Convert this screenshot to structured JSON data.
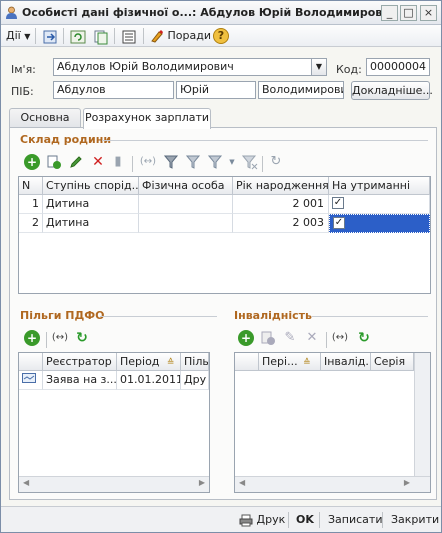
{
  "window": {
    "title": "Особисті дані фізичної о...: Абдулов Юрій Володимирович *",
    "controls": [
      "_",
      "□",
      "×"
    ]
  },
  "toolbar": {
    "actions_label": "Дії",
    "tips_label": "Поради",
    "help_label": "?"
  },
  "form": {
    "name_label": "Ім'я:",
    "name_value": "Абдулов Юрій Володимирович",
    "code_label": "Код:",
    "code_value": "00000004",
    "pib_label": "ПІБ:",
    "surname": "Абдулов",
    "firstname": "Юрій",
    "patronymic": "Володимирович",
    "details_button": "Докладніше..."
  },
  "tabs": [
    {
      "label": "Основна",
      "active": false
    },
    {
      "label": "Розрахунок зарплати",
      "active": true
    }
  ],
  "family": {
    "section_title": "Склад родини",
    "columns": [
      "N",
      "Ступінь спорід...",
      "Фізична особа",
      "Рік народження",
      "На утриманні"
    ],
    "rows": [
      {
        "n": "1",
        "relation": "Дитина",
        "person": "",
        "year": "2 001",
        "dependent": true
      },
      {
        "n": "2",
        "relation": "Дитина",
        "person": "",
        "year": "2 003",
        "dependent": true
      }
    ]
  },
  "benefits": {
    "section_title": "Пільги ПДФО",
    "columns": [
      "Реєстратор",
      "Період",
      "Піль"
    ],
    "rows": [
      {
        "registrar": "Заява на з...",
        "period": "01.01.2011",
        "benefit": "Дру"
      }
    ]
  },
  "disability": {
    "section_title": "Інвалідність",
    "columns": [
      "Пері...",
      "Інвалід...",
      "Серія"
    ]
  },
  "footer": {
    "print_label": "Друк",
    "ok_label": "OK",
    "save_label": "Записати",
    "close_label": "Закрити"
  },
  "colors": {
    "section_title": "#b06820",
    "selected_row": "#2c5fc8",
    "add_icon": "#3a9a2a",
    "delete_icon": "#d02020"
  }
}
